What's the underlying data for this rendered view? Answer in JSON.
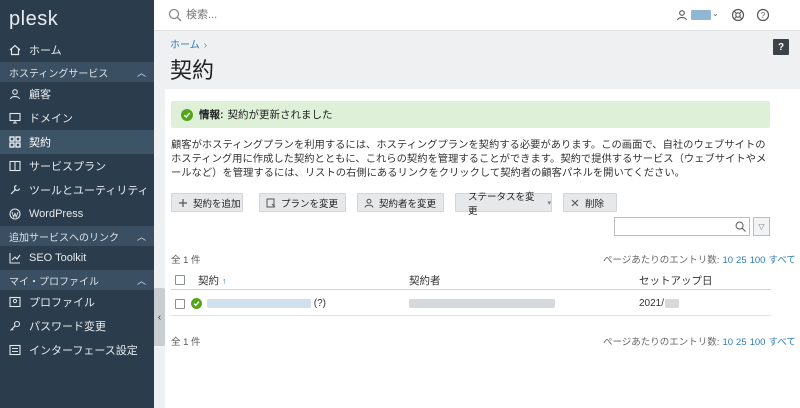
{
  "app": {
    "logo": "plesk"
  },
  "search": {
    "placeholder": "検索..."
  },
  "sidebar": {
    "items": [
      {
        "label": "ホーム",
        "icon": "home-icon"
      },
      {
        "section": "ホスティングサービス"
      },
      {
        "label": "顧客",
        "icon": "user-icon"
      },
      {
        "label": "ドメイン",
        "icon": "monitor-icon"
      },
      {
        "label": "契約",
        "icon": "grid-icon",
        "active": true
      },
      {
        "label": "サービスプラン",
        "icon": "book-icon"
      },
      {
        "label": "ツールとユーティリティ",
        "icon": "wrench-icon"
      },
      {
        "label": "WordPress",
        "icon": "wordpress-icon"
      },
      {
        "section": "追加サービスへのリンク"
      },
      {
        "label": "SEO Toolkit",
        "icon": "chart-icon"
      },
      {
        "section": "マイ・プロファイル"
      },
      {
        "label": "プロファイル",
        "icon": "profile-icon"
      },
      {
        "label": "パスワード変更",
        "icon": "key-icon"
      },
      {
        "label": "インターフェース設定",
        "icon": "settings-list-icon"
      }
    ]
  },
  "breadcrumb": {
    "home": "ホーム",
    "sep": "›"
  },
  "page": {
    "title": "契約",
    "help": "?"
  },
  "message": {
    "label": "情報:",
    "text": "契約が更新されました"
  },
  "description": "顧客がホスティングプランを利用するには、ホスティングプランを契約する必要があります。この画面で、自社のウェブサイトのホスティング用に作成した契約とともに、これらの契約を管理することができます。契約で提供するサービス（ウェブサイトやメールなど）を管理するには、リストの右側にあるリンクをクリックして契約者の顧客パネルを開いてください。",
  "toolbar": {
    "add": "契約を追加",
    "change_plan": "プランを変更",
    "change_owner": "契約者を変更",
    "change_status": "ステータスを変更",
    "delete": "削除"
  },
  "list": {
    "count_top": "全 1 件",
    "count_bottom": "全 1 件",
    "pager_label": "ページあたりのエントリ数:",
    "pager_options": [
      "10",
      "25",
      "100",
      "すべて"
    ],
    "columns": {
      "subscription": "契約",
      "sort_arrow": "↑",
      "owner": "契約者",
      "setup_date": "セットアップ日"
    },
    "rows": [
      {
        "subscription_suffix": "(?)",
        "setup_date": "2021/"
      }
    ]
  },
  "colors": {
    "sidebar_bg": "#2b3d4c",
    "accent_link": "#2e7cb8",
    "success": "#55a51c",
    "message_bg": "#dff0d8"
  }
}
